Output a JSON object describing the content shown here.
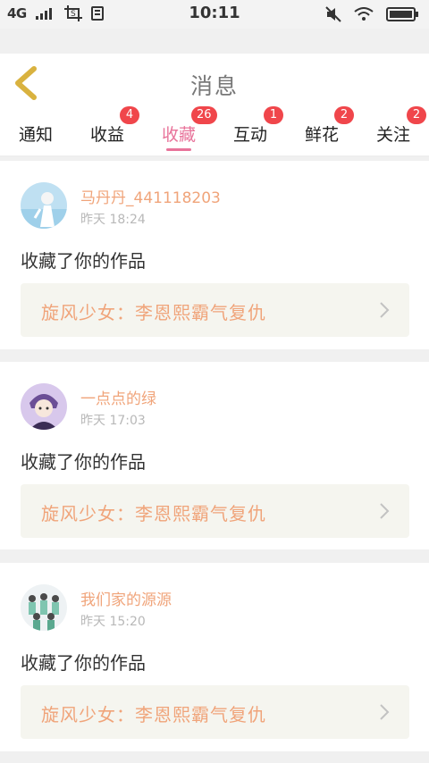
{
  "status_bar": {
    "network": "4G",
    "time": "10:11"
  },
  "header": {
    "title": "消息"
  },
  "tabs": [
    {
      "label": "通知",
      "badge": ""
    },
    {
      "label": "收益",
      "badge": "4"
    },
    {
      "label": "收藏",
      "badge": "26",
      "active": true
    },
    {
      "label": "互动",
      "badge": "1"
    },
    {
      "label": "鲜花",
      "badge": "2"
    },
    {
      "label": "关注",
      "badge": "2"
    }
  ],
  "messages": [
    {
      "user": "马丹丹_441118203",
      "time": "昨天 18:24",
      "action": "收藏了你的作品",
      "work": "旋风少女：李恩熙霸气复仇"
    },
    {
      "user": "一点点的绿",
      "time": "昨天 17:03",
      "action": "收藏了你的作品",
      "work": "旋风少女：李恩熙霸气复仇"
    },
    {
      "user": "我们家的源源",
      "time": "昨天 15:20",
      "action": "收藏了你的作品",
      "work": "旋风少女：李恩熙霸气复仇"
    }
  ],
  "colors": {
    "accent_pink": "#e8739a",
    "badge_red": "#f0464b",
    "name_orange": "#f0a47a",
    "back_yellow": "#d9b23f"
  }
}
